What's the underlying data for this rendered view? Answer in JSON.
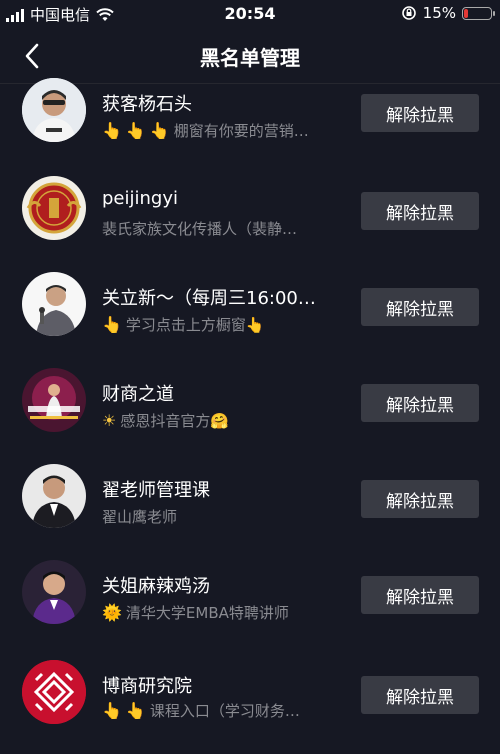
{
  "status": {
    "carrier": "中国电信",
    "time": "20:54",
    "battery_pct": "15%",
    "battery_level": 0.15,
    "battery_color": "#e53935"
  },
  "header": {
    "title": "黑名单管理",
    "back_icon": "chevron-left-icon"
  },
  "button_label": "解除拉黑",
  "users": [
    {
      "name": "获客杨石头",
      "desc": "棚窗有你要的营销…",
      "desc_icons": [
        "👆",
        "👆",
        "👆"
      ]
    },
    {
      "name": "peijingyi",
      "desc": "裴氏家族文化传播人（裴静…",
      "desc_icons": []
    },
    {
      "name": "关立新～（每周三16:00…",
      "desc": "学习点击上方橱窗👆",
      "desc_icons": [
        "👆"
      ]
    },
    {
      "name": "财商之道",
      "desc": "感恩抖音官方🤗",
      "desc_icons": [
        "☀"
      ]
    },
    {
      "name": "翟老师管理课",
      "desc": "翟山鹰老师",
      "desc_icons": []
    },
    {
      "name": "关姐麻辣鸡汤",
      "desc": "清华大学EMBA特聘讲师",
      "desc_icons": [
        "🌞"
      ]
    },
    {
      "name": "博商研究院",
      "desc": "课程入口（学习财务…",
      "desc_icons": [
        "👆",
        "👆"
      ]
    }
  ]
}
